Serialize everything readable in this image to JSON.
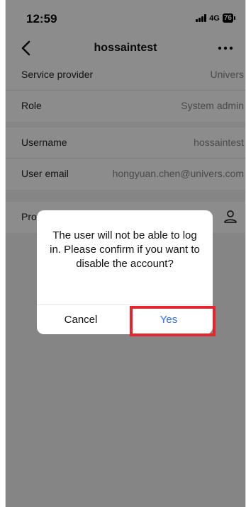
{
  "status_bar": {
    "time": "12:59",
    "network": "4G",
    "battery": "76"
  },
  "nav": {
    "title": "hossaintest",
    "back_icon": "chevron-left-icon",
    "more_icon": "more-horizontal-icon"
  },
  "sections": {
    "org": [
      {
        "label": "Service provider",
        "value": "Univers"
      },
      {
        "label": "Role",
        "value": "System admin"
      }
    ],
    "account": [
      {
        "label": "Username",
        "value": "hossaintest"
      },
      {
        "label": "User email",
        "value": "hongyuan.chen@univers.com"
      }
    ],
    "profile": [
      {
        "label": "Profile photo",
        "icon": "person-icon"
      }
    ]
  },
  "dialog": {
    "message": "The user will not be able to log in. Please confirm if you want to disable the account?",
    "cancel_label": "Cancel",
    "confirm_label": "Yes"
  },
  "colors": {
    "confirm_text": "#2f6de0",
    "highlight": "#e4252c",
    "overlay": "rgba(0,0,0,0.45)"
  }
}
